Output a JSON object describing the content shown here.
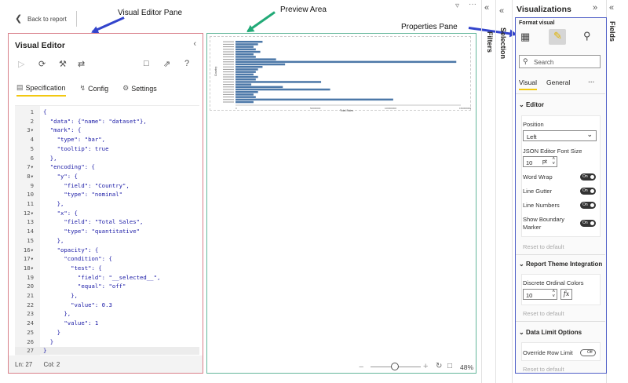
{
  "annotations": {
    "visual_editor_pane": "Visual Editor Pane",
    "preview_area": "Preview Area",
    "properties_pane": "Properties Pane"
  },
  "topbar": {
    "back_label": "Back to report"
  },
  "editor": {
    "title": "Visual Editor",
    "tabs": [
      "Specification",
      "Config",
      "Settings"
    ],
    "code_lines": [
      "{",
      "  \"data\": {\"name\": \"dataset\"},",
      "  \"mark\": {",
      "    \"type\": \"bar\",",
      "    \"tooltip\": true",
      "  },",
      "  \"encoding\": {",
      "    \"y\": {",
      "      \"field\": \"Country\",",
      "      \"type\": \"nominal\"",
      "    },",
      "    \"x\": {",
      "      \"field\": \"Total Sales\",",
      "      \"type\": \"quantitative\"",
      "    },",
      "    \"opacity\": {",
      "      \"condition\": {",
      "        \"test\": {",
      "          \"field\": \"__selected__\",",
      "          \"equal\": \"off\"",
      "        },",
      "        \"value\": 0.3",
      "      },",
      "      \"value\": 1",
      "    }",
      "  }",
      "}"
    ],
    "status_ln": "Ln: 27",
    "status_col": "Col: 2"
  },
  "preview": {
    "zoom": "48%",
    "zoom_fraction": 0.48,
    "chart_ylabel": "Country",
    "chart_xlabel": "Total Sales",
    "bar_fractions": [
      0.12,
      0.1,
      0.08,
      0.09,
      0.11,
      0.08,
      0.09,
      0.18,
      0.98,
      0.22,
      0.12,
      0.1,
      0.09,
      0.08,
      0.1,
      0.09,
      0.38,
      0.07,
      0.21,
      0.42,
      0.1,
      0.08,
      0.09,
      0.7,
      0.08
    ],
    "x_ticks": [
      "0",
      "50000000",
      "100000000",
      "150000000"
    ]
  },
  "side": {
    "filters": "Filters",
    "selection": "Selection",
    "fields": "Fields"
  },
  "viz": {
    "title": "Visualizations",
    "format_visual": "Format visual",
    "search_placeholder": "Search",
    "tab_visual": "Visual",
    "tab_general": "General",
    "more": "...",
    "section_editor": "Editor",
    "position_label": "Position",
    "position_value": "Left",
    "font_size_label": "JSON Editor Font Size",
    "font_size_value": "10",
    "font_size_unit": "pt",
    "word_wrap": "Word Wrap",
    "line_gutter": "Line Gutter",
    "line_numbers": "Line Numbers",
    "show_boundary": "Show Boundary Marker",
    "toggle_on": "On",
    "toggle_off": "Off",
    "reset": "Reset to default",
    "section_theme": "Report Theme Integration",
    "discrete_ordinal": "Discrete Ordinal Colors",
    "discrete_value": "10",
    "fx": "fx",
    "section_limit": "Data Limit Options",
    "override_row": "Override Row Limit"
  }
}
